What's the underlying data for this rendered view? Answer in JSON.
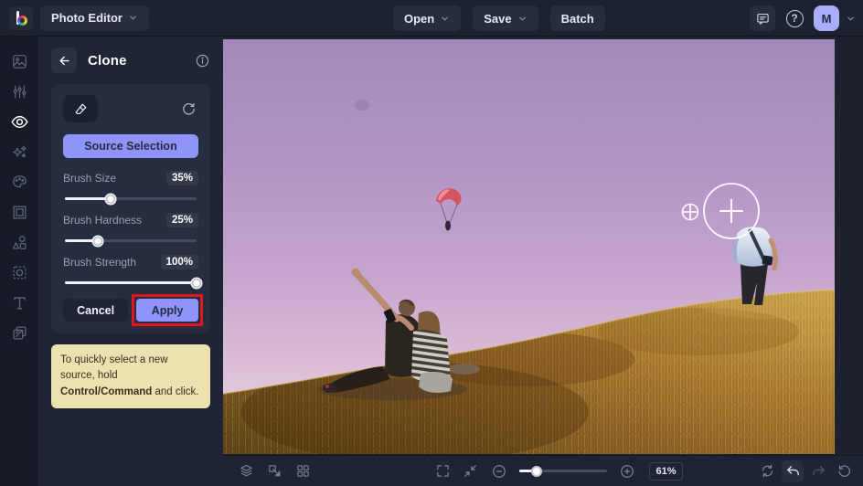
{
  "app": {
    "brand_letter": "b",
    "title": "Photo Editor"
  },
  "topbar": {
    "open_label": "Open",
    "save_label": "Save",
    "batch_label": "Batch",
    "avatar_initial": "M",
    "icons": [
      "feedback-chat-icon",
      "help-icon",
      "account-chevron-icon"
    ]
  },
  "sidebar": {
    "active_index": 2,
    "icons": [
      "photo-edit-icon",
      "adjustments-icon",
      "touch-up-eye-icon",
      "effects-sparkle-icon",
      "artsy-palette-icon",
      "frames-icon",
      "graphics-shapes-icon",
      "overlays-icon",
      "text-icon",
      "textures-icon"
    ]
  },
  "panel": {
    "title": "Clone",
    "source_selection_label": "Source Selection",
    "sliders": [
      {
        "label": "Brush Size",
        "value": "35%",
        "percent": 35
      },
      {
        "label": "Brush Hardness",
        "value": "25%",
        "percent": 25
      },
      {
        "label": "Brush Strength",
        "value": "100%",
        "percent": 100
      }
    ],
    "cancel_label": "Cancel",
    "apply_label": "Apply",
    "tooltip": {
      "pre": "To quickly select a new source, hold ",
      "bold": "Control/Command",
      "post": " and click."
    },
    "annotation_color": "#e41523",
    "accent_color": "#8e94f9",
    "tooltip_bg": "#ece2b0"
  },
  "statusbar": {
    "zoom_level": "61%",
    "zoom_percent": 20,
    "left_icons": [
      "layers-icon",
      "resize-icon",
      "grid-view-icon"
    ],
    "center_icons": [
      "fullscreen-icon",
      "fit-screen-icon",
      "zoom-out-icon",
      "zoom-in-icon"
    ],
    "right_icons": [
      "compare-icon",
      "undo-icon",
      "redo-icon",
      "history-icon"
    ]
  },
  "canvas": {
    "description": "Couple taking selfie on golden hill under purple sky, paraglider, standing headless figure being cloned out",
    "clone_brush": {
      "source_marker": "crosshair-circle",
      "brush_cursor": "plus-circle"
    },
    "sky_top_color": "#a18abc",
    "sky_bottom_color": "#ecdce4",
    "grass_color": "#a5762e"
  }
}
